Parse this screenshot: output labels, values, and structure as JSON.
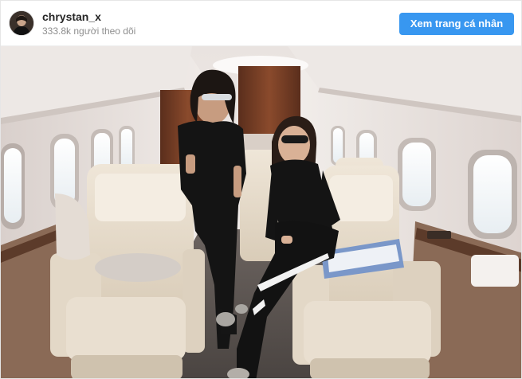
{
  "account": {
    "username": "chrystan_x",
    "followers_text": "333.8k người theo dõi",
    "avatar_icon": "profile-photo"
  },
  "actions": {
    "view_profile_label": "Xem trang cá nhân"
  },
  "colors": {
    "accent": "#3897f0",
    "username_text": "#262626",
    "secondary_text": "#8e8e8e"
  },
  "post": {
    "media_type": "photo"
  }
}
